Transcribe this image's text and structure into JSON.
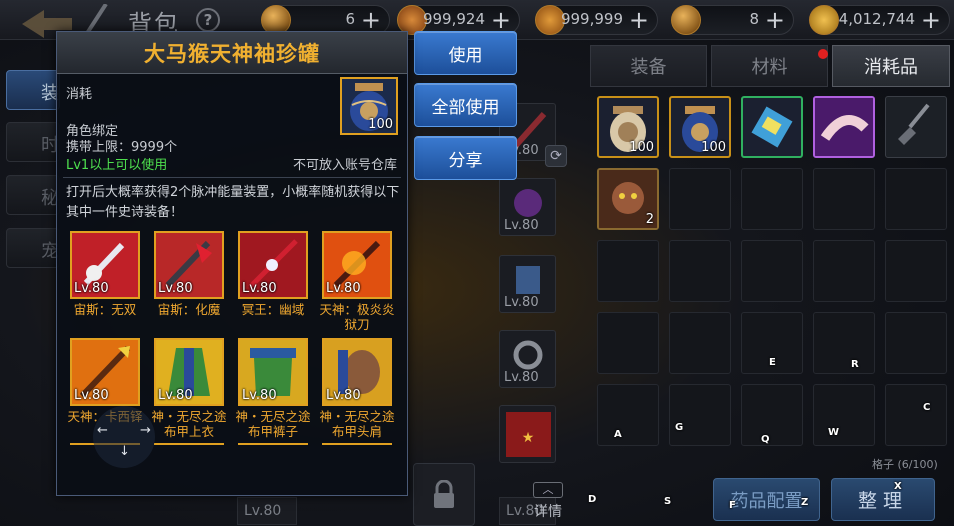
{
  "topbar": {
    "title": "背包",
    "help": "?",
    "currencies": [
      {
        "icon": "gold-coin-icon",
        "value": "6",
        "plus": "+"
      },
      {
        "icon": "scroll-ticket-icon",
        "value": "999,924",
        "plus": "+"
      },
      {
        "icon": "locked-scroll-icon",
        "value": "999,999",
        "plus": "+"
      },
      {
        "icon": "coin-icon",
        "value": "8",
        "plus": "+"
      },
      {
        "icon": "gold-ingot-icon",
        "value": "4,012,744",
        "plus": "+"
      }
    ]
  },
  "left_tabs": [
    "装",
    "时",
    "秘",
    "宠"
  ],
  "popup": {
    "title": "大马猴天神袖珍罐",
    "type": "消耗",
    "bind": "角色绑定",
    "limit": "携带上限：9999个",
    "level_req": "Lv1以上可以使用",
    "storage_note": "不可放入账号仓库",
    "icon_count": "100",
    "description": "打开后大概率获得2个脉冲能量装置，小概率随机获得以下其中一件史诗装备！",
    "rewards": [
      {
        "level": "Lv.80",
        "name": "宙斯：无双",
        "icon": "sword-icon",
        "bg": "#c02028"
      },
      {
        "level": "Lv.80",
        "name": "宙斯：化魔",
        "icon": "axe-icon",
        "bg": "#b82828"
      },
      {
        "level": "Lv.80",
        "name": "冥王：幽域",
        "icon": "blade-icon",
        "bg": "#a01820"
      },
      {
        "level": "Lv.80",
        "name": "天神：极炎炎狱刀",
        "icon": "fire-blade-icon",
        "bg": "#e05010"
      },
      {
        "level": "Lv.80",
        "name": "天神：卡西铎",
        "icon": "spear-icon",
        "bg": "#e07010"
      },
      {
        "level": "Lv.80",
        "name": "神・无尽之途布甲上衣",
        "icon": "robe-icon",
        "bg": "#e0b020"
      },
      {
        "level": "Lv.80",
        "name": "神・无尽之途布甲裤子",
        "icon": "pants-icon",
        "bg": "#d8a820"
      },
      {
        "level": "Lv.80",
        "name": "神・无尽之途布甲头肩",
        "icon": "shoulder-icon",
        "bg": "#d8a020"
      }
    ],
    "arrow_left": "←",
    "arrow_right": "→",
    "arrow_down": "↓"
  },
  "actions": {
    "use": "使用",
    "use_all": "全部使用",
    "share": "分享"
  },
  "middle": {
    "slot_level": "Lv.80",
    "detail": "详情",
    "detail_chevron": "︿"
  },
  "inventory": {
    "tabs": [
      "装备",
      "材料",
      "消耗品"
    ],
    "active_tab": "消耗品",
    "items": [
      {
        "icon": "jar-icon",
        "count": "100"
      },
      {
        "icon": "blue-jar-icon",
        "count": "100"
      },
      {
        "icon": "ticket-icon",
        "count": ""
      },
      {
        "icon": "glove-icon",
        "count": ""
      },
      {
        "icon": "shovel-icon",
        "count": ""
      },
      {
        "icon": "monkey-icon",
        "count": "2"
      }
    ],
    "slots_count": "格子 (6/100)",
    "potion_button": "药品配置",
    "sort_button": "整理"
  },
  "keys": [
    "E",
    "R",
    "C",
    "A",
    "G",
    "Q",
    "W",
    "D",
    "S",
    "F",
    "Z",
    "X"
  ]
}
